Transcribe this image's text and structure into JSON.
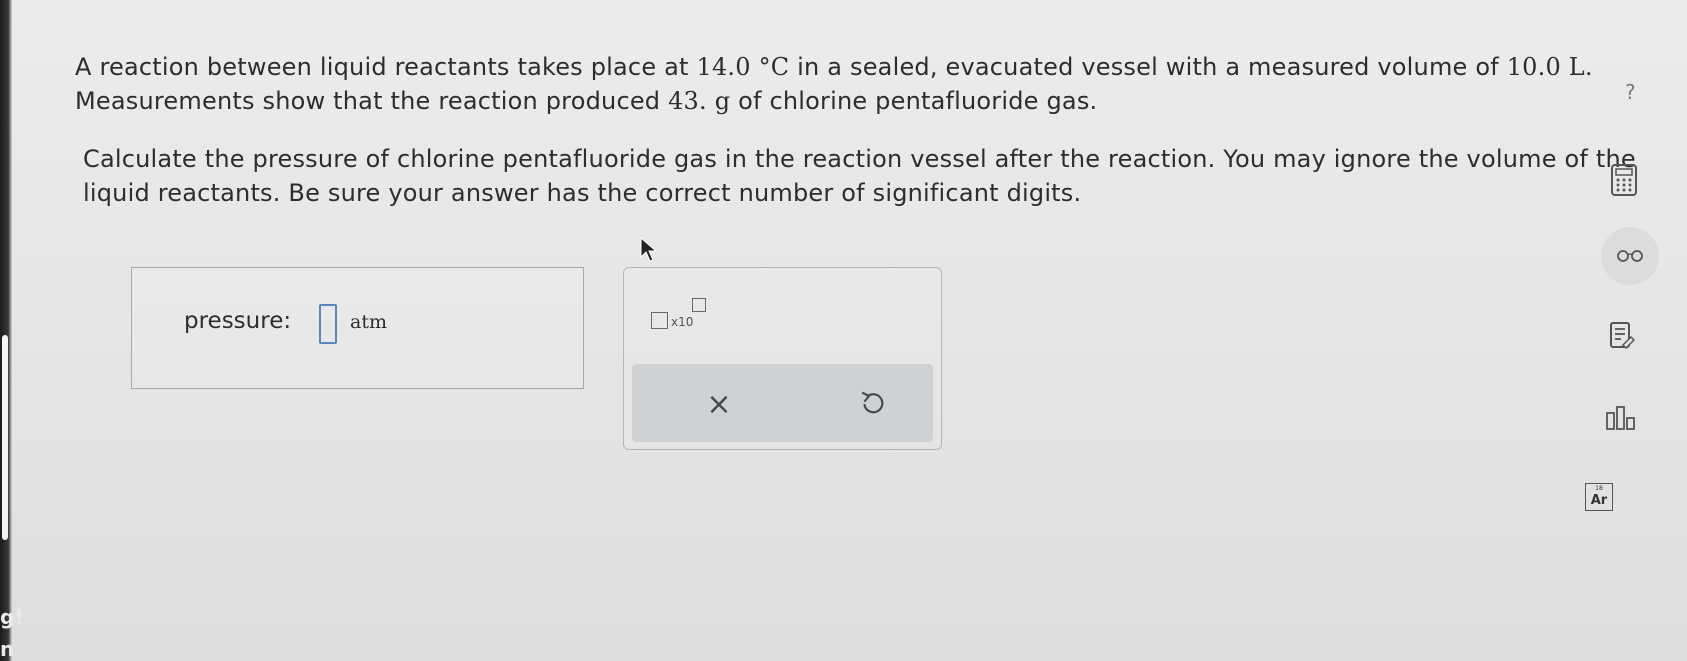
{
  "question": {
    "s1_a": "A reaction between liquid reactants takes place at ",
    "temp": "14.0",
    "temp_unit": "°C",
    "s1_b": " in a sealed, evacuated vessel with a measured volume of ",
    "volume": "10.0",
    "volume_unit": "L.",
    "s2_a": "Measurements show that the reaction produced ",
    "mass": "43.",
    "mass_unit": "g",
    "s2_b": " of chlorine pentafluoride gas.",
    "p2": "Calculate the pressure of chlorine pentafluoride gas in the reaction vessel after the reaction. You may ignore the volume of the liquid reactants. Be sure your answer has the correct number of significant digits."
  },
  "answer": {
    "label": "pressure:",
    "value": "",
    "unit": "atm"
  },
  "tool_panel": {
    "x10_label": "x10",
    "clear_symbol": "×"
  },
  "side": {
    "help": "?",
    "periodic_number": "18",
    "periodic_symbol": "Ar"
  },
  "left_edge": {
    "frag1": "g!",
    "frag2": "n"
  },
  "colors": {
    "input_border": "#5a86c0",
    "action_bar": "#cfd2d5"
  }
}
